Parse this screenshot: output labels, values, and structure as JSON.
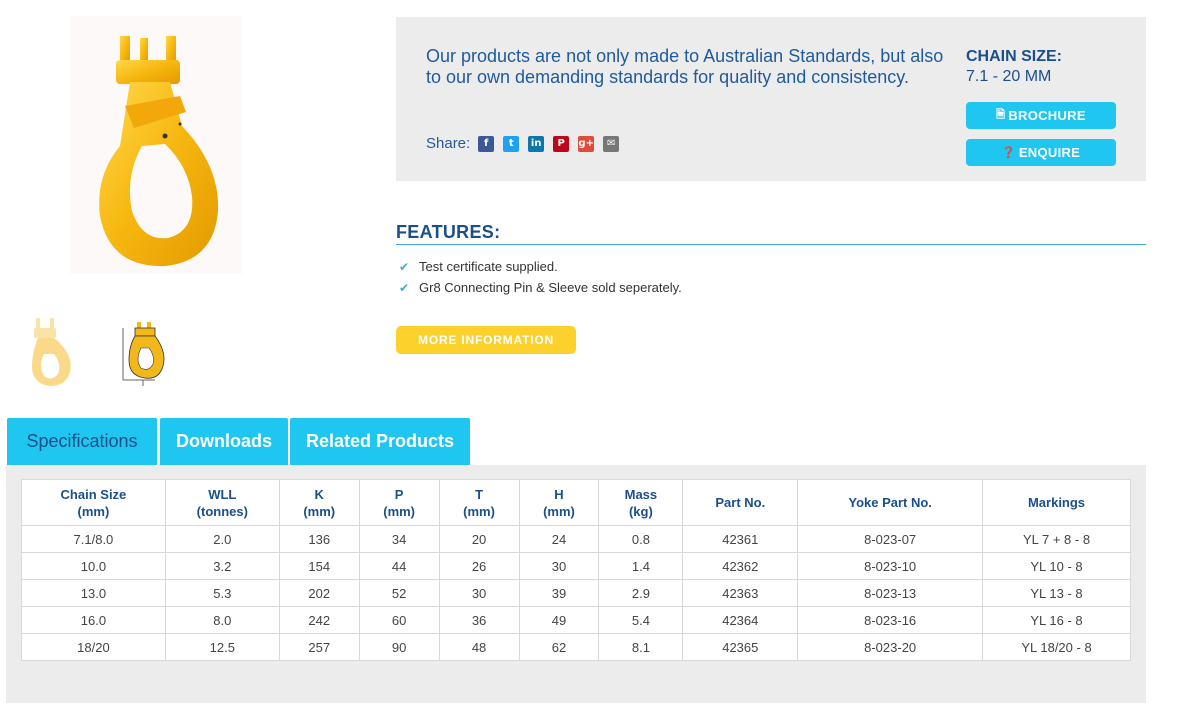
{
  "info": {
    "text": "Our products are not only made to Australian Standards, but also to our own demanding standards for quality and consistency.",
    "share_label": "Share:",
    "share_icons": [
      {
        "name": "facebook-icon",
        "glyph": "f",
        "color": "#3b5998"
      },
      {
        "name": "twitter-icon",
        "glyph": "t",
        "color": "#1da1f2"
      },
      {
        "name": "linkedin-icon",
        "glyph": "in",
        "color": "#0e76a8"
      },
      {
        "name": "pinterest-icon",
        "glyph": "P",
        "color": "#bd081c"
      },
      {
        "name": "googleplus-icon",
        "glyph": "g+",
        "color": "#dd4b39"
      },
      {
        "name": "email-icon",
        "glyph": "✉",
        "color": "#777777"
      }
    ],
    "chain_size_title": "CHAIN SIZE:",
    "chain_size_value": "7.1 - 20 MM",
    "brochure_label": "BROCHURE",
    "enquire_label": "ENQUIRE"
  },
  "features": {
    "title": "FEATURES:",
    "items": [
      "Test certificate supplied.",
      "Gr8 Connecting Pin & Sleeve sold seperately."
    ],
    "more_label": "MORE INFORMATION"
  },
  "tabs": [
    {
      "label": "Specifications"
    },
    {
      "label": "Downloads"
    },
    {
      "label": "Related Products"
    }
  ],
  "table": {
    "headers": [
      [
        "Chain Size",
        "(mm)"
      ],
      [
        "WLL",
        "(tonnes)"
      ],
      [
        "K",
        "(mm)"
      ],
      [
        "P",
        "(mm)"
      ],
      [
        "T",
        "(mm)"
      ],
      [
        "H",
        "(mm)"
      ],
      [
        "Mass",
        "(kg)"
      ],
      [
        "Part No.",
        ""
      ],
      [
        "Yoke Part No.",
        ""
      ],
      [
        "Markings",
        ""
      ]
    ],
    "rows": [
      [
        "7.1/8.0",
        "2.0",
        "136",
        "34",
        "20",
        "24",
        "0.8",
        "42361",
        "8-023-07",
        "YL 7 + 8 - 8"
      ],
      [
        "10.0",
        "3.2",
        "154",
        "44",
        "26",
        "30",
        "1.4",
        "42362",
        "8-023-10",
        "YL 10 - 8"
      ],
      [
        "13.0",
        "5.3",
        "202",
        "52",
        "30",
        "39",
        "2.9",
        "42363",
        "8-023-13",
        "YL 13 - 8"
      ],
      [
        "16.0",
        "8.0",
        "242",
        "60",
        "36",
        "49",
        "5.4",
        "42364",
        "8-023-16",
        "YL 16 - 8"
      ],
      [
        "18/20",
        "12.5",
        "257",
        "90",
        "48",
        "62",
        "8.1",
        "42365",
        "8-023-20",
        "YL 18/20 - 8"
      ]
    ]
  },
  "colors": {
    "brand_blue": "#1a4f8c",
    "cyan": "#1fc6f0",
    "yellow": "#fcd12b",
    "panel_gray": "#ececec"
  }
}
